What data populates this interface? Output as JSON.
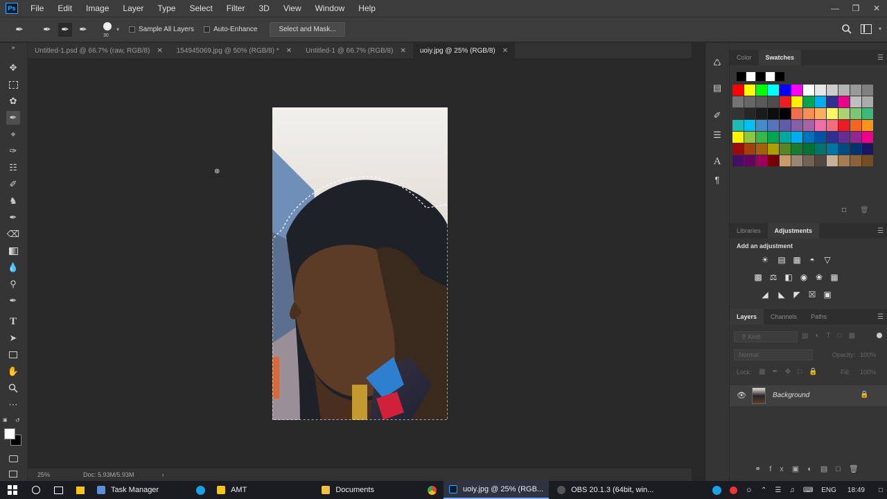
{
  "app": {
    "logo_text": "Ps"
  },
  "menus": [
    "File",
    "Edit",
    "Image",
    "Layer",
    "Type",
    "Select",
    "Filter",
    "3D",
    "View",
    "Window",
    "Help"
  ],
  "options_bar": {
    "brush_size": "30",
    "sample_all_layers": "Sample All Layers",
    "auto_enhance": "Auto-Enhance",
    "select_and_mask": "Select and Mask..."
  },
  "tabs": [
    {
      "label": "Untitled-1.psd @ 66.7% (raw, RGB/8)",
      "active": false
    },
    {
      "label": "154945069.jpg @ 50% (RGB/8) *",
      "active": false
    },
    {
      "label": "Untitled-1 @ 66.7% (RGB/8)",
      "active": false
    },
    {
      "label": "uoiy.jpg @ 25% (RGB/8)",
      "active": true
    }
  ],
  "status": {
    "zoom": "25%",
    "doc_size": "Doc: 5.93M/5.93M"
  },
  "color_panel": {
    "tabs": [
      "Color",
      "Swatches"
    ],
    "active": "Swatches"
  },
  "adjust_panel": {
    "tabs": [
      "Libraries",
      "Adjustments"
    ],
    "active": "Adjustments",
    "hint": "Add an adjustment"
  },
  "layers_panel": {
    "tabs": [
      "Layers",
      "Channels",
      "Paths"
    ],
    "active": "Layers",
    "kind_placeholder": "Kind",
    "blend_mode": "Normal",
    "opacity_label": "Opacity:",
    "opacity_value": "100%",
    "lock_label": "Lock:",
    "fill_label": "Fill:",
    "fill_value": "100%",
    "layer_name": "Background"
  },
  "taskbar": {
    "apps": [
      {
        "label": "Task Manager",
        "active": false,
        "color": "#5a8fd8"
      },
      {
        "label": "AMT",
        "active": false,
        "color": "#f5c518"
      },
      {
        "label": "Documents",
        "active": false,
        "color": "#f0c040"
      },
      {
        "label": "uoiy.jpg @ 25% (RGB...",
        "active": true,
        "color": "#31a8ff"
      },
      {
        "label": "OBS 20.1.3 (64bit, win...",
        "active": false,
        "color": "#888888"
      }
    ],
    "lang": "ENG",
    "time": "18:49"
  },
  "colors": {
    "accent": "#31a8ff",
    "panel": "#353535",
    "canvas": "#282828"
  }
}
